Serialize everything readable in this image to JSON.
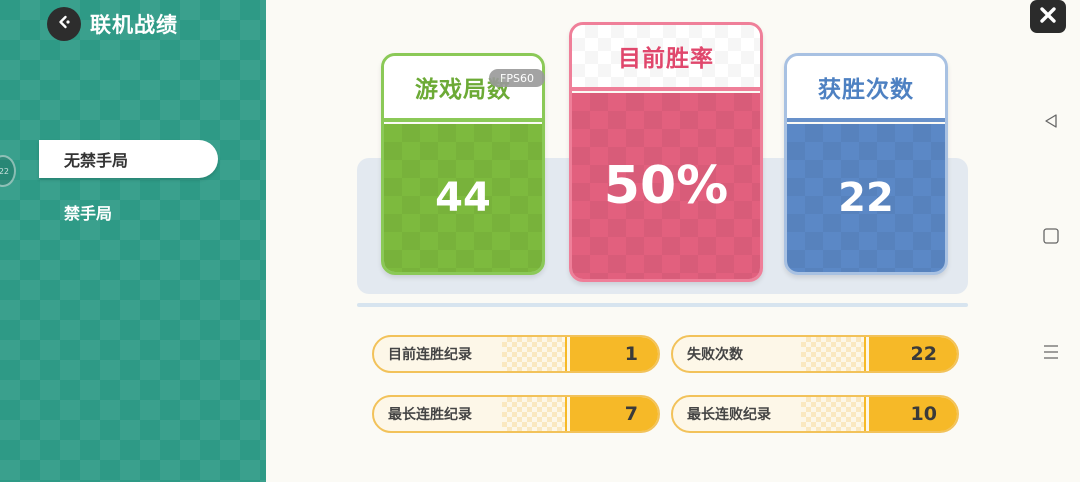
{
  "header": {
    "title": "联机战绩",
    "back_icon": "back-arrow-icon"
  },
  "sidebar": {
    "edge_badge": "22",
    "tabs": [
      {
        "label": "无禁手局",
        "active": true
      },
      {
        "label": "禁手局",
        "active": false
      }
    ]
  },
  "stats": {
    "games": {
      "label": "游戏局数",
      "value": "44"
    },
    "win_rate": {
      "label": "目前胜率",
      "value": "50%"
    },
    "wins": {
      "label": "获胜次数",
      "value": "22"
    }
  },
  "fps_badge": "FPS60",
  "records": [
    {
      "label": "目前连胜纪录",
      "value": "1"
    },
    {
      "label": "失败次数",
      "value": "22"
    },
    {
      "label": "最长连胜纪录",
      "value": "7"
    },
    {
      "label": "最长连败纪录",
      "value": "10"
    }
  ],
  "controls": {
    "close_icon": "close-icon",
    "nav_icons": [
      "back-triangle-icon",
      "home-square-icon",
      "menu-icon"
    ]
  },
  "colors": {
    "sidebar": "#2e9a86",
    "games_green": "#7dba3e",
    "win_rate_pink": "#e2607e",
    "wins_blue": "#5b88c6",
    "record_gold": "#f6b928"
  }
}
